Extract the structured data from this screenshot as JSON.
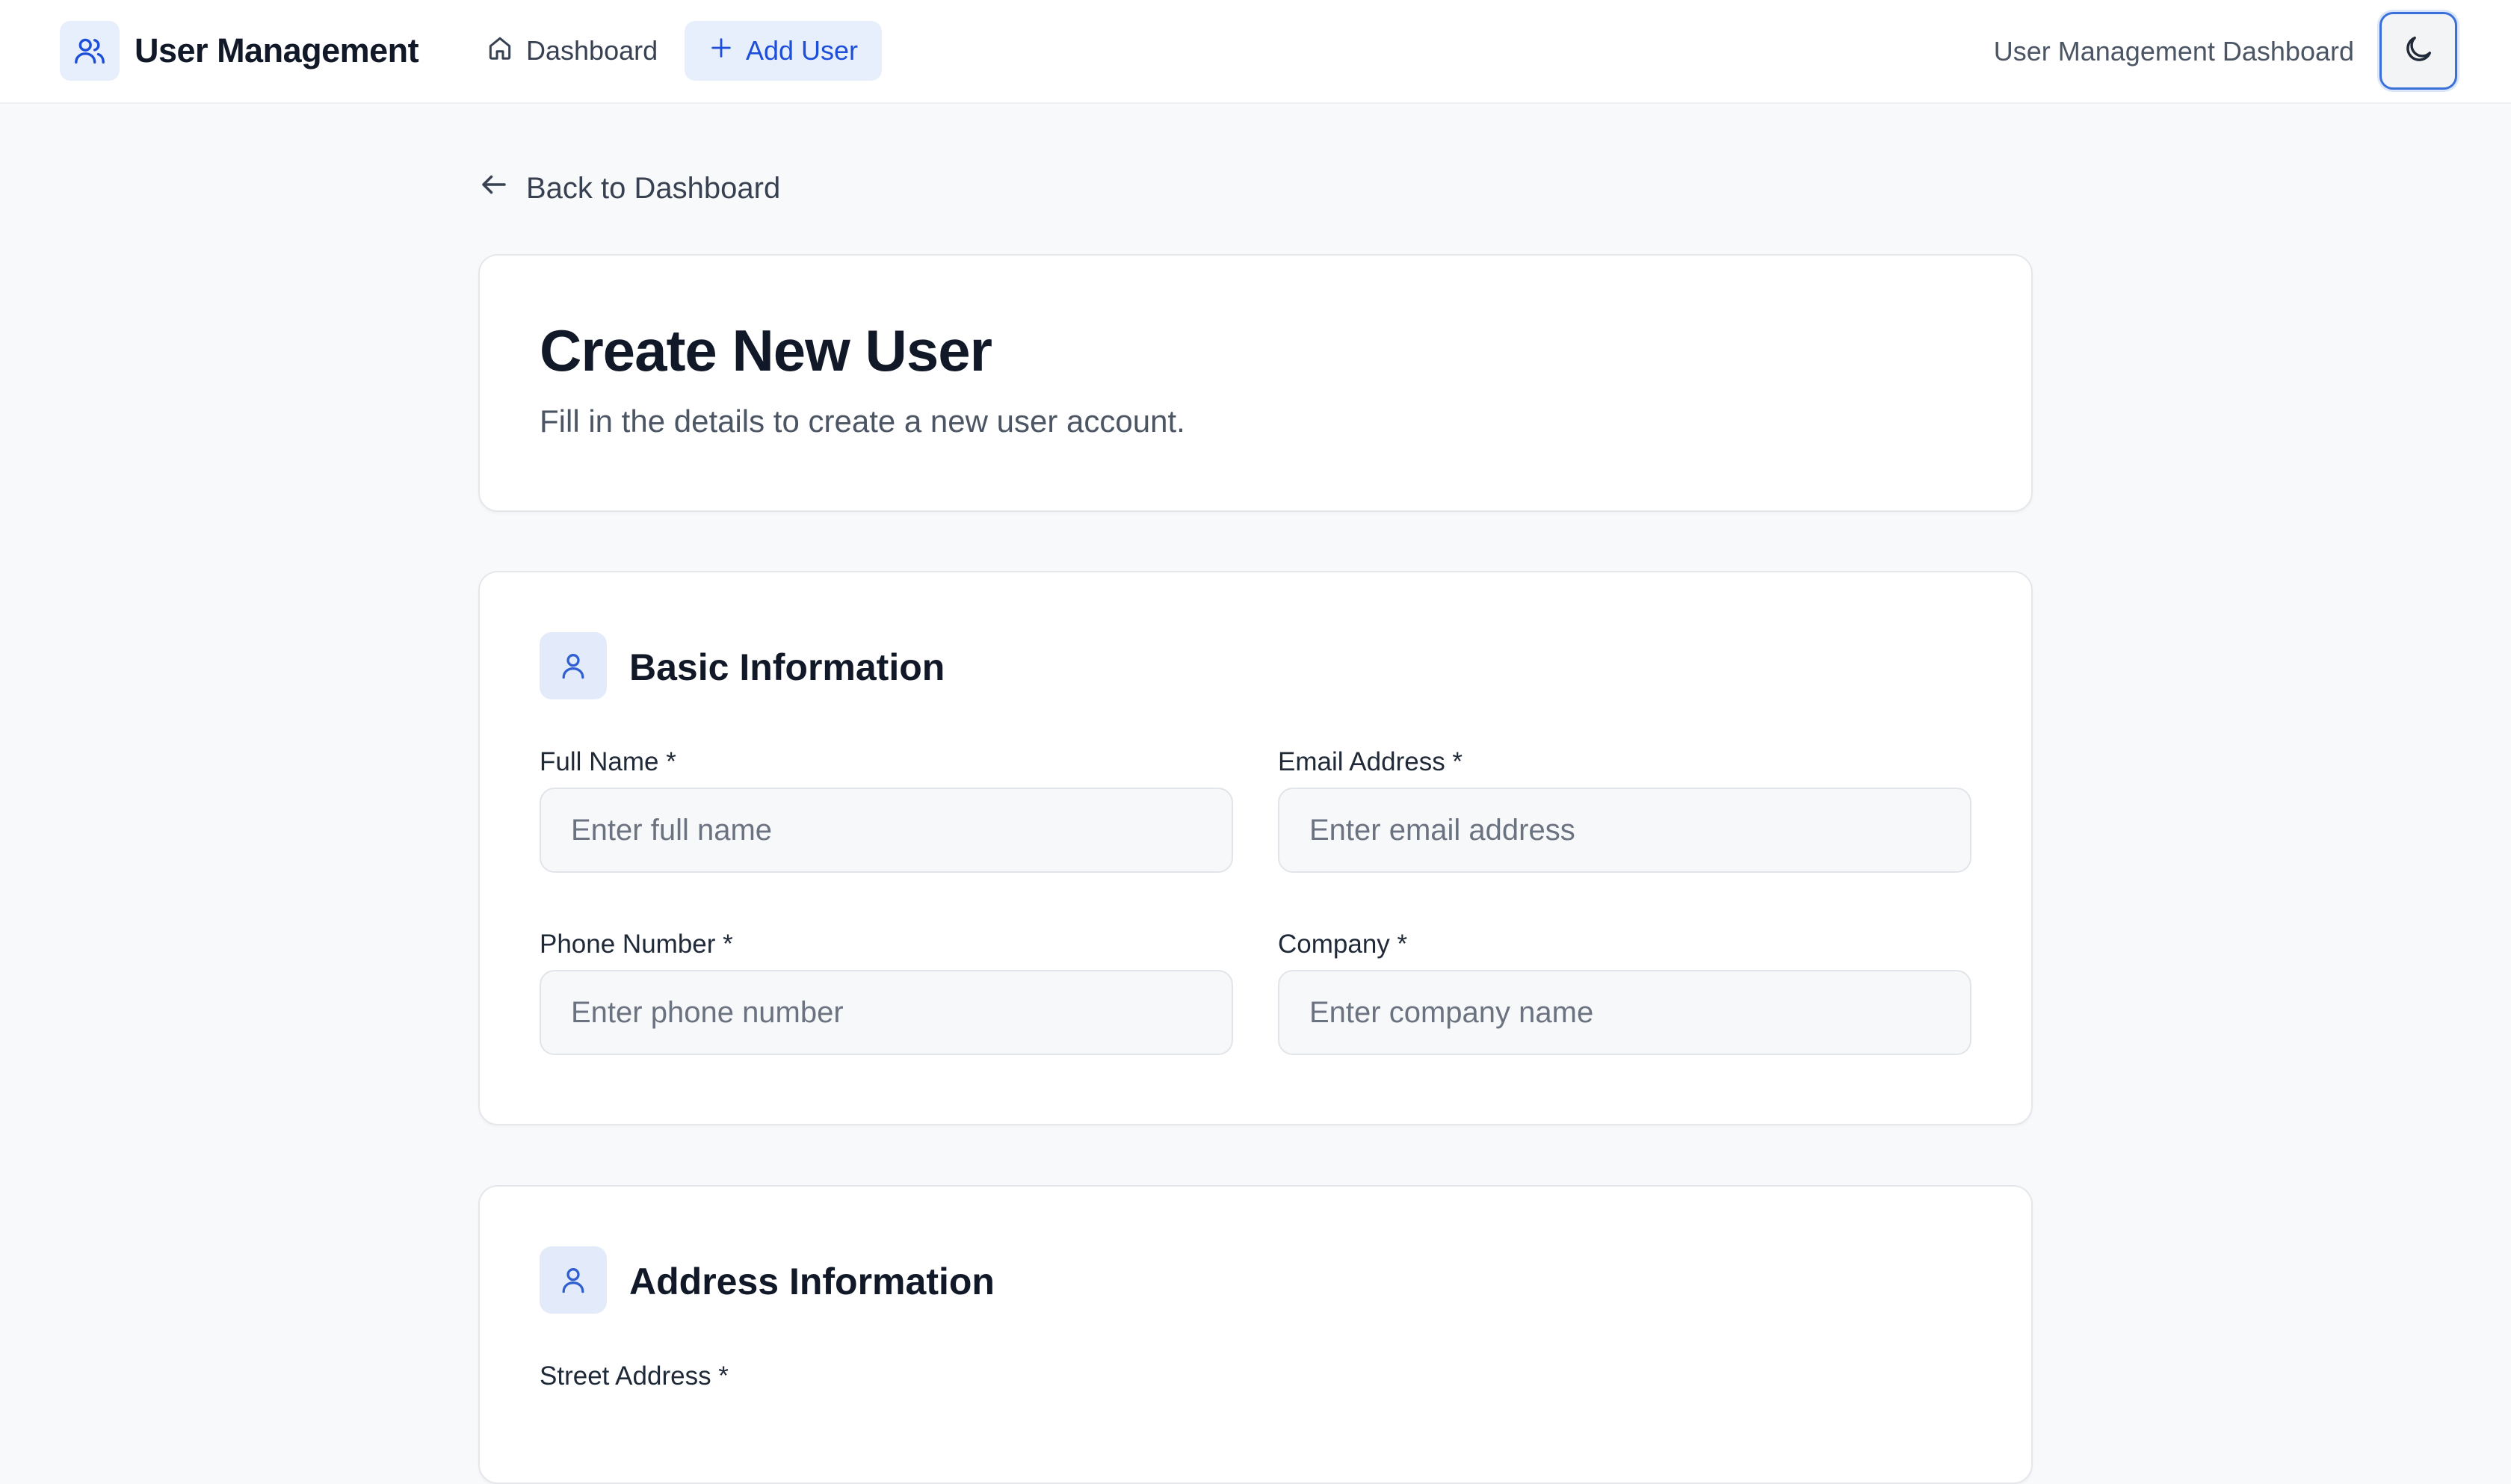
{
  "nav": {
    "brand_title": "User Management",
    "dashboard_label": "Dashboard",
    "add_user_label": "Add User",
    "subtitle": "User Management Dashboard"
  },
  "back_link": {
    "label": "Back to Dashboard"
  },
  "header": {
    "title": "Create New User",
    "subtitle": "Fill in the details to create a new user account."
  },
  "basic_info": {
    "title": "Basic Information",
    "fields": [
      {
        "label": "Full Name *",
        "placeholder": "Enter full name",
        "value": ""
      },
      {
        "label": "Email Address *",
        "placeholder": "Enter email address",
        "value": ""
      },
      {
        "label": "Phone Number *",
        "placeholder": "Enter phone number",
        "value": ""
      },
      {
        "label": "Company *",
        "placeholder": "Enter company name",
        "value": ""
      }
    ]
  },
  "address_info": {
    "title": "Address Information",
    "fields": [
      {
        "label": "Street Address *"
      }
    ]
  },
  "colors": {
    "accent": "#1d4ed8",
    "accent_bg": "#e8effc",
    "background": "#f8f9fb"
  },
  "icons": {
    "brand": "users-icon",
    "dashboard": "home-icon",
    "add_user": "plus-icon",
    "theme": "moon-icon",
    "back": "arrow-left-icon",
    "section": "user-icon"
  }
}
